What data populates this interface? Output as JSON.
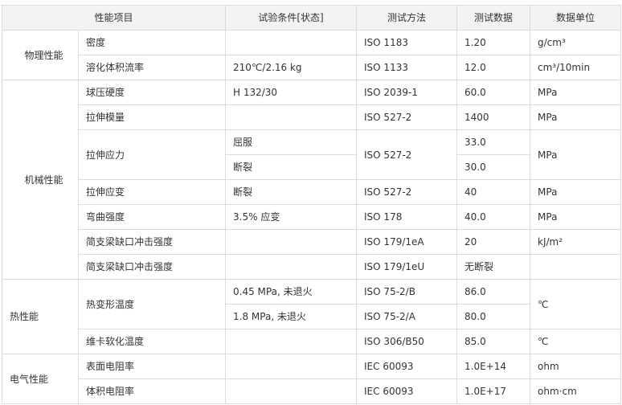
{
  "headers": [
    "性能项目",
    "试验条件[状态]",
    "测试方法",
    "测试数据",
    "数据单位"
  ],
  "rows": {
    "physical": "物理性能",
    "density": {
      "name": "密度",
      "cond": "",
      "method": "ISO 1183",
      "value": "1.20",
      "unit": "g/cm³"
    },
    "mfr": {
      "name": "溶化体积流率",
      "cond": "210℃/2.16 kg",
      "method": "ISO 1133",
      "value": "12.0",
      "unit": "cm³/10min"
    },
    "mechanical": "机械性能",
    "ball": {
      "name": "球压硬度",
      "cond": "H 132/30",
      "method": "ISO 2039-1",
      "value": "60.0",
      "unit": "MPa"
    },
    "modulus": {
      "name": "拉伸模量",
      "cond": "",
      "method": "ISO 527-2",
      "value": "1400",
      "unit": "MPa"
    },
    "stress": {
      "name": "拉伸应力",
      "cond_yield": "屈服",
      "cond_break": "断裂",
      "method": "ISO 527-2",
      "value_yield": "33.0",
      "value_break": "30.0",
      "unit": "MPa"
    },
    "strain": {
      "name": "拉伸应变",
      "cond": "断裂",
      "method": "ISO 527-2",
      "value": "40",
      "unit": "MPa"
    },
    "flex": {
      "name": "弯曲强度",
      "cond": "3.5% 应变",
      "method": "ISO 178",
      "value": "40.0",
      "unit": "MPa"
    },
    "charpy_a": {
      "name": "简支梁缺口冲击强度",
      "cond": "",
      "method": "ISO 179/1eA",
      "value": "20",
      "unit": "kJ/m²"
    },
    "charpy_u": {
      "name": "简支梁缺口冲击强度",
      "cond": "",
      "method": "ISO 179/1eU",
      "value": "无断裂",
      "unit": ""
    },
    "thermal": "热性能",
    "hdt": {
      "name": "热变形温度",
      "cond_b": "0.45 MPa, 未退火",
      "cond_a": "1.8 MPa, 未退火",
      "method_b": "ISO 75-2/B",
      "method_a": "ISO 75-2/A",
      "value_b": "86.0",
      "value_a": "80.0",
      "unit": "℃"
    },
    "vicat": {
      "name": "维卡软化温度",
      "cond": "",
      "method": "ISO 306/B50",
      "value": "85.0",
      "unit": "℃"
    },
    "electrical": "电气性能",
    "surface": {
      "name": "表面电阻率",
      "cond": "",
      "method": "IEC 60093",
      "value": "1.0E+14",
      "unit": "ohm"
    },
    "volume": {
      "name": "体积电阻率",
      "cond": "",
      "method": "IEC 60093",
      "value": "1.0E+17",
      "unit": "ohm·cm"
    }
  }
}
